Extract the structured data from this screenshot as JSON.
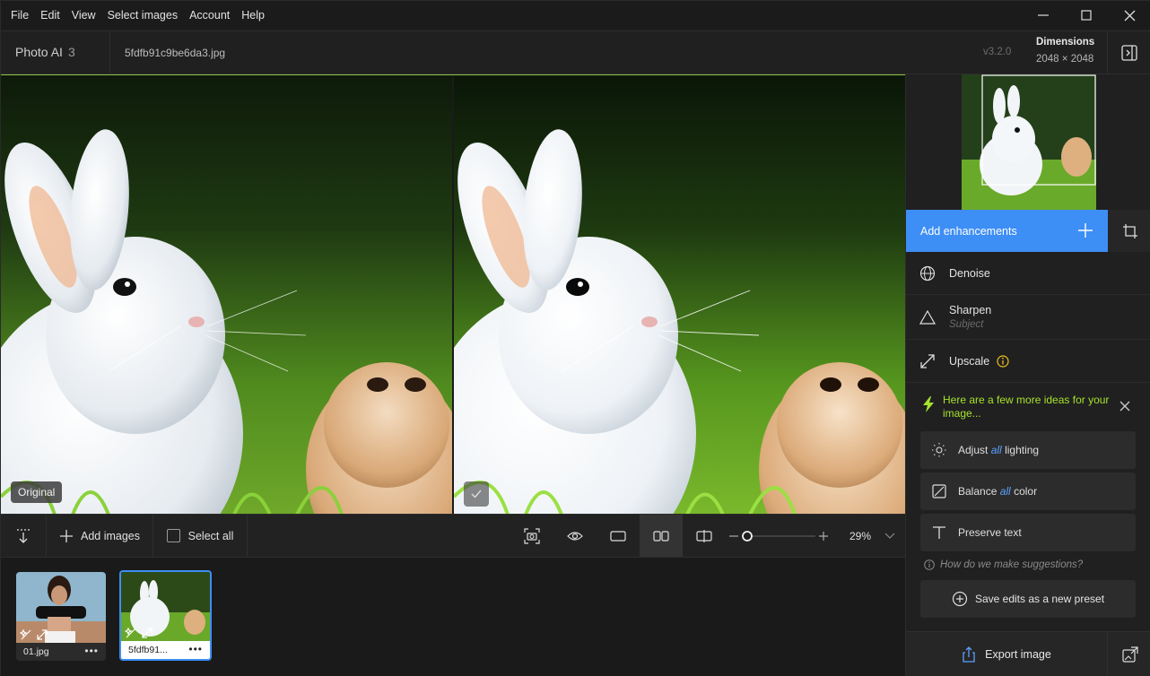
{
  "menu": [
    "File",
    "Edit",
    "View",
    "Select images",
    "Account",
    "Help"
  ],
  "app": {
    "name": "Photo AI",
    "version_num": "3",
    "file": "5fdfb91c9be6da3.jpg",
    "build": "v3.2.0"
  },
  "dimensions": {
    "label": "Dimensions",
    "value": "2048 × 2048"
  },
  "viewer": {
    "original_label": "Original"
  },
  "toolbar": {
    "add_images": "Add images",
    "select_all": "Select all",
    "zoom": "29%"
  },
  "filmstrip": [
    {
      "name": "01.jpg"
    },
    {
      "name": "5fdfb91..."
    }
  ],
  "panel": {
    "add_enhancements": "Add enhancements",
    "enhancements": [
      {
        "label": "Denoise",
        "sub": ""
      },
      {
        "label": "Sharpen",
        "sub": "Subject"
      },
      {
        "label": "Upscale",
        "sub": ""
      }
    ],
    "ideas": "Here are a few more ideas for your image...",
    "suggestions": [
      {
        "pre": "Adjust",
        "em": "all",
        "post": "lighting"
      },
      {
        "pre": "Balance",
        "em": "all",
        "post": "color"
      },
      {
        "pre": "Preserve text",
        "em": "",
        "post": ""
      }
    ],
    "how": "How do we make suggestions?",
    "save_preset": "Save edits as a new preset",
    "export": "Export image"
  },
  "colors": {
    "accent": "#3d8ef5",
    "ideas": "#a6e22e"
  }
}
